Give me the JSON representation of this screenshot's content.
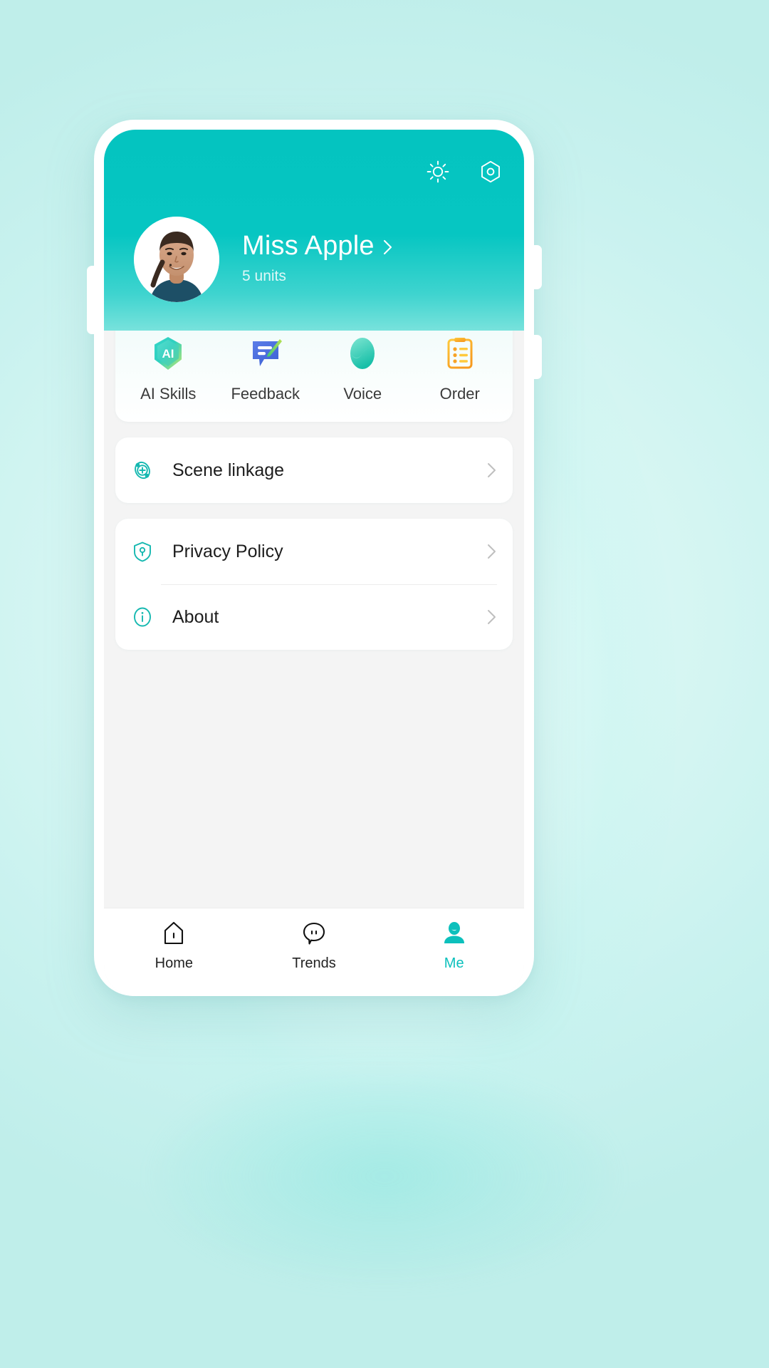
{
  "theme": {
    "accent": "#0cc0bc",
    "header_gradient_from": "#04c4c0",
    "header_gradient_to": "#78e2dc",
    "page_background": "#d4f5f1",
    "card_background": "#ffffff",
    "body_background": "#f4f4f4",
    "text_primary": "#1d1d1d",
    "text_on_accent": "#ffffff"
  },
  "header": {
    "icons": [
      {
        "name": "brightness-icon",
        "label": "Brightness"
      },
      {
        "name": "settings-hex-icon",
        "label": "Settings"
      }
    ],
    "profile": {
      "avatar_alt": "User portrait photo",
      "name": "Miss Apple",
      "chevron": "›",
      "subtitle": "5 units"
    }
  },
  "quick_actions": [
    {
      "label": "AI Skills",
      "icon": "ai-skills-icon"
    },
    {
      "label": "Feedback",
      "icon": "feedback-icon"
    },
    {
      "label": "Voice",
      "icon": "voice-icon"
    },
    {
      "label": "Order",
      "icon": "order-icon"
    }
  ],
  "sections": [
    {
      "name": "scene-linkage-card",
      "rows": [
        {
          "label": "Scene linkage",
          "icon": "scene-linkage-icon"
        }
      ]
    },
    {
      "name": "info-card",
      "rows": [
        {
          "label": "Privacy Policy",
          "icon": "shield-lock-icon"
        },
        {
          "label": "About",
          "icon": "info-circle-icon"
        }
      ]
    }
  ],
  "tabbar": {
    "items": [
      {
        "label": "Home",
        "icon": "home-icon",
        "active": false
      },
      {
        "label": "Trends",
        "icon": "chat-bubble-icon",
        "active": false
      },
      {
        "label": "Me",
        "icon": "person-icon",
        "active": true
      }
    ]
  }
}
